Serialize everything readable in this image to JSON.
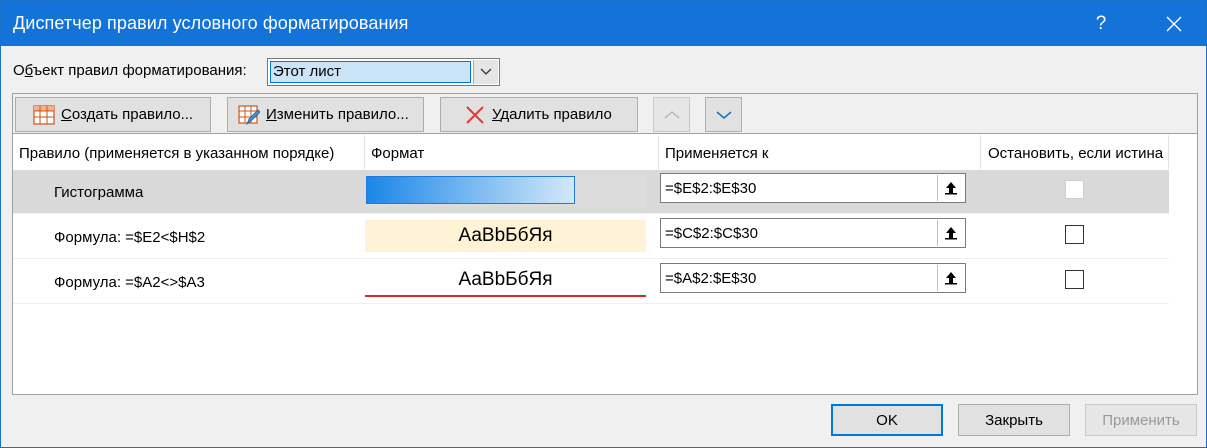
{
  "window": {
    "title": "Диспетчер правил условного форматирования",
    "help_label": "?",
    "accent": "#1473d8"
  },
  "scope": {
    "label_prefix": "О",
    "label_accel": "б",
    "label_rest": "ъект правил форматирования:",
    "value": "Этот лист"
  },
  "toolbar": {
    "create": {
      "accel": "С",
      "rest": "оздать правило...",
      "icon": "new-rule-icon"
    },
    "edit": {
      "accel": "И",
      "rest": "зменить правило...",
      "icon": "edit-rule-icon"
    },
    "delete": {
      "accel": "У",
      "rest": "далить правило",
      "icon": "delete-x-icon"
    },
    "move_up": {
      "icon": "chevron-up-icon"
    },
    "move_down": {
      "icon": "chevron-down-icon"
    }
  },
  "table": {
    "headers": {
      "rule": "Правило (применяется в указанном порядке)",
      "format": "Формат",
      "applies": "Применяется к",
      "stop": "Остановить, если истина"
    },
    "rows": [
      {
        "rule": "Гистограмма",
        "format_type": "databar",
        "applies": "=$E$2:$E$30",
        "stop": false,
        "selected": true,
        "databar_fill": 0.75
      },
      {
        "rule": "Формула: =$E2<$H$2",
        "format_type": "text",
        "preview": "АаBbБбЯя",
        "applies": "=$C$2:$C$30",
        "stop": false,
        "selected": false
      },
      {
        "rule": "Формула: =$A2<>$A3",
        "format_type": "text",
        "preview": "АаBbБбЯя",
        "applies": "=$A$2:$E$30",
        "stop": false,
        "selected": false
      }
    ]
  },
  "footer": {
    "ok": "OK",
    "close": "Закрыть",
    "apply": "Применить"
  }
}
